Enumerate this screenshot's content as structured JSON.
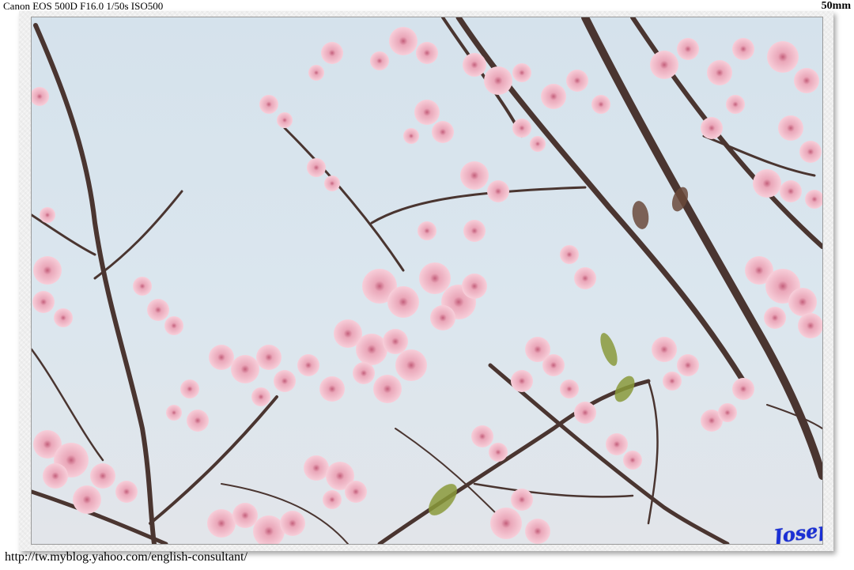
{
  "caption": {
    "exif": "Canon EOS 500D F16.0 1/50s ISO500",
    "focal_length": "50mm",
    "url": "http://tw.myblog.yahoo.com/english-consultant/"
  },
  "photo": {
    "subject": "pink cherry blossoms on branches against pale blue sky",
    "signature": "Joseph",
    "colors": {
      "sky": "#d8e4ed",
      "blossom": "#f2b9c8",
      "blossom_dark": "#d9849c",
      "branch": "#4a3530",
      "leaf": "#8a9a3a"
    }
  }
}
